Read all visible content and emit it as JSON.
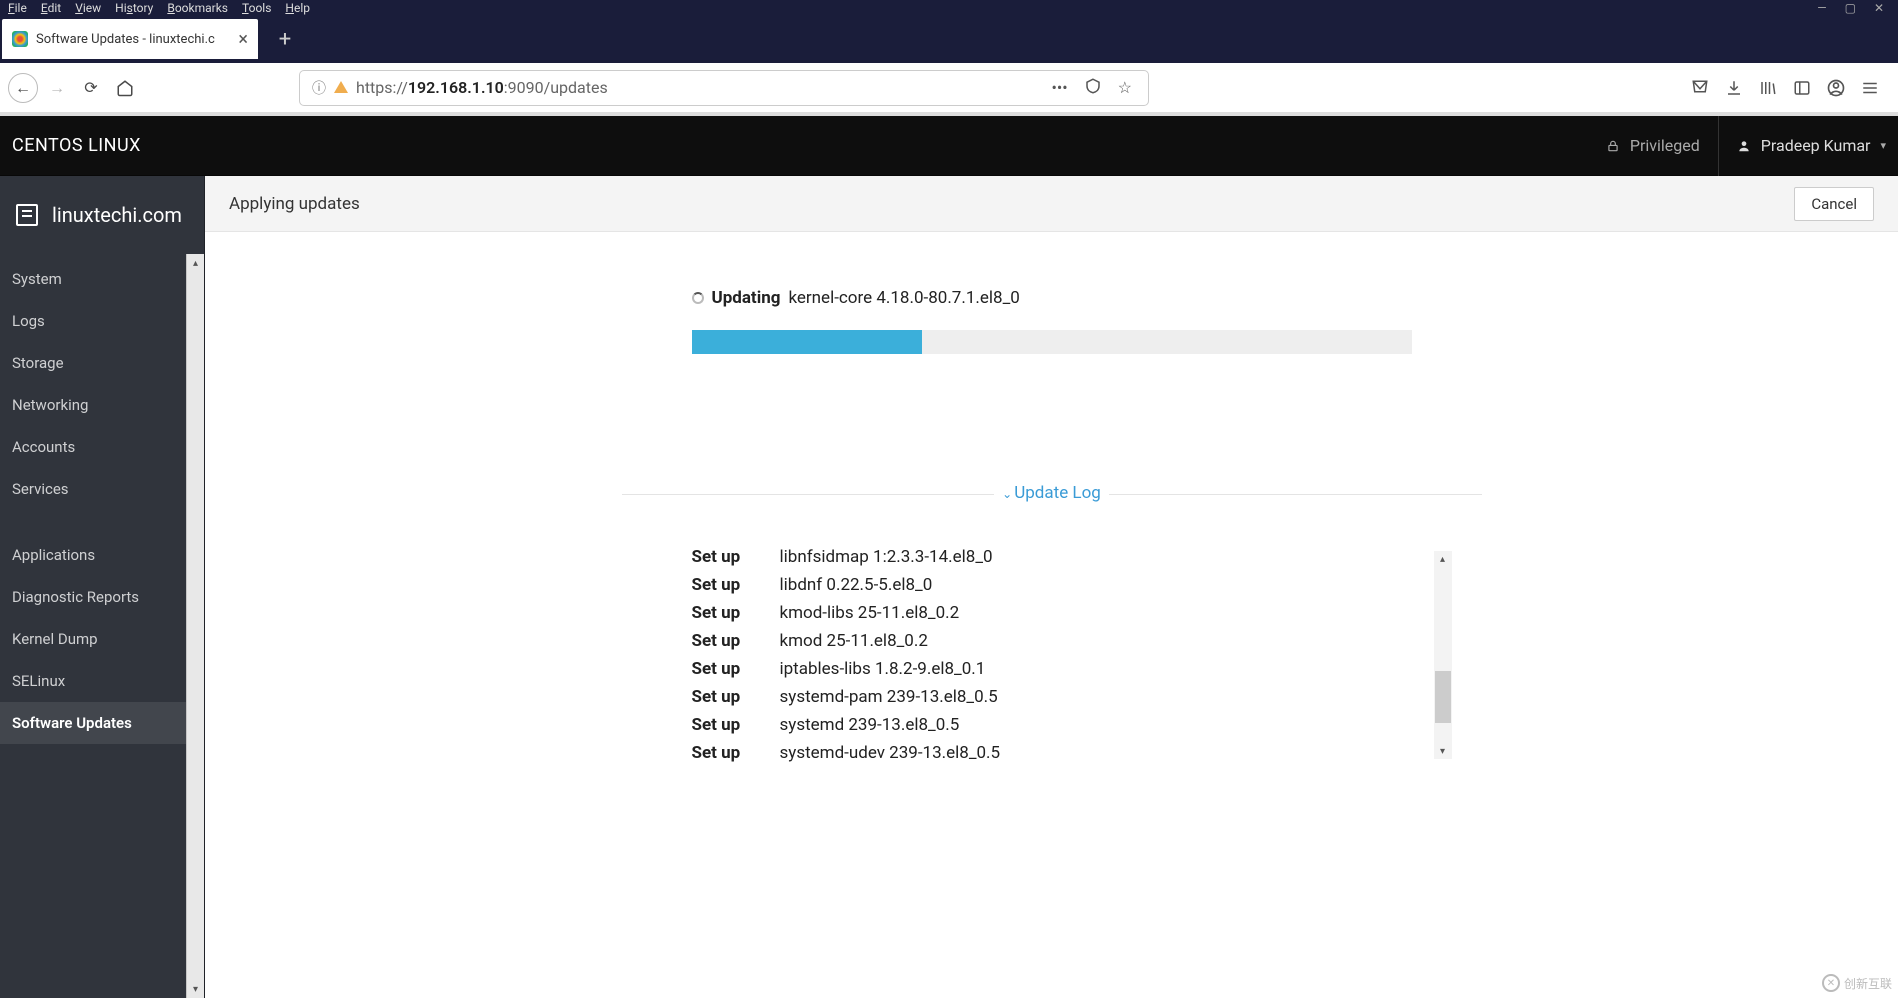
{
  "menubar": [
    "File",
    "Edit",
    "View",
    "History",
    "Bookmarks",
    "Tools",
    "Help"
  ],
  "tab": {
    "title": "Software Updates - linuxtechi.c"
  },
  "url": {
    "prefix": "https://",
    "host": "192.168.1.10",
    "port": ":9090",
    "path": "/updates"
  },
  "header": {
    "brand": "CENTOS LINUX",
    "priv": "Privileged",
    "user": "Pradeep Kumar"
  },
  "host": "linuxtechi.com",
  "nav": {
    "items": [
      "System",
      "Logs",
      "Storage",
      "Networking",
      "Accounts",
      "Services"
    ],
    "items2": [
      "Applications",
      "Diagnostic Reports",
      "Kernel Dump",
      "SELinux",
      "Software Updates"
    ],
    "active": "Software Updates"
  },
  "page": {
    "title": "Applying updates",
    "cancel": "Cancel"
  },
  "update": {
    "action": "Updating",
    "pkg": "kernel-core 4.18.0-80.7.1.el8_0",
    "progress_pct": 32,
    "log_label": "Update Log",
    "log": [
      {
        "action": "Set up",
        "pkg": "libnfsidmap 1:2.3.3-14.el8_0"
      },
      {
        "action": "Set up",
        "pkg": "libdnf 0.22.5-5.el8_0"
      },
      {
        "action": "Set up",
        "pkg": "kmod-libs 25-11.el8_0.2"
      },
      {
        "action": "Set up",
        "pkg": "kmod 25-11.el8_0.2"
      },
      {
        "action": "Set up",
        "pkg": "iptables-libs 1.8.2-9.el8_0.1"
      },
      {
        "action": "Set up",
        "pkg": "systemd-pam 239-13.el8_0.5"
      },
      {
        "action": "Set up",
        "pkg": "systemd 239-13.el8_0.5"
      },
      {
        "action": "Set up",
        "pkg": "systemd-udev 239-13.el8_0.5"
      }
    ]
  },
  "watermark": "创新互联"
}
